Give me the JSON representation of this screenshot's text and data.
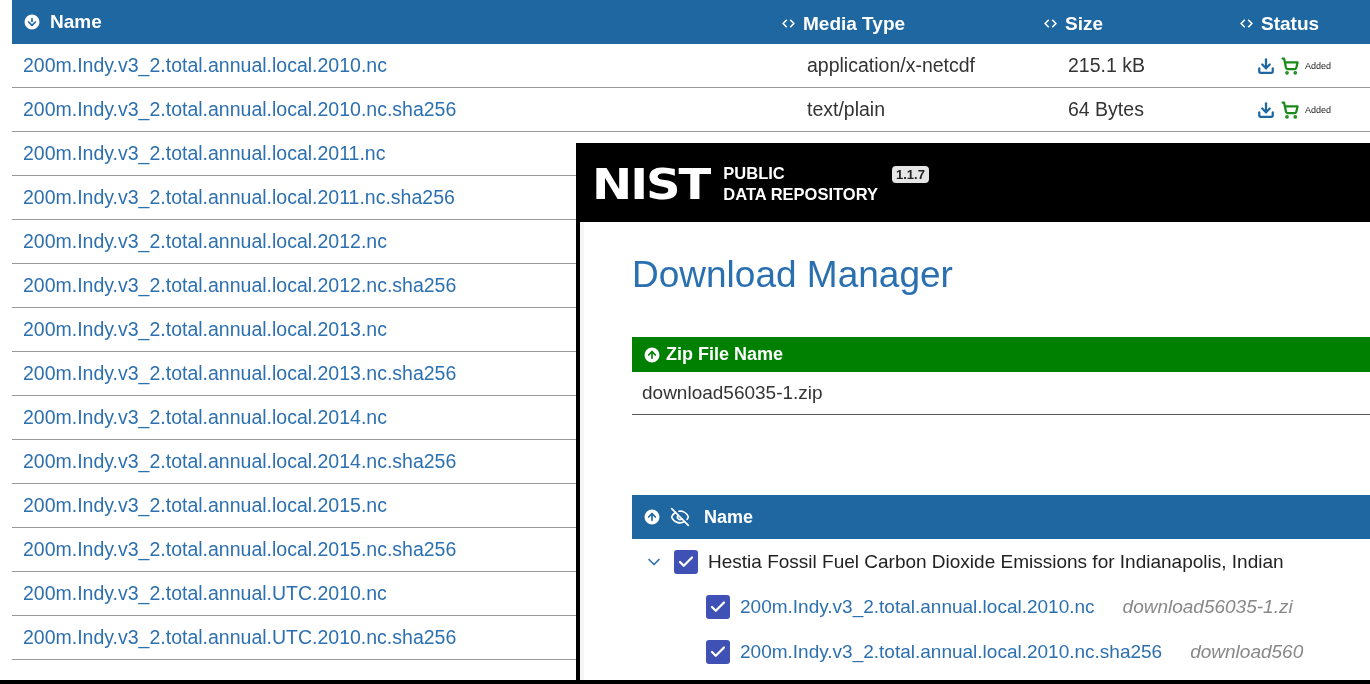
{
  "file_table": {
    "columns": [
      {
        "label": "Name",
        "kind": "sort"
      },
      {
        "label": "Media Type",
        "kind": "toggle"
      },
      {
        "label": "Size",
        "kind": "toggle"
      },
      {
        "label": "Status",
        "kind": "toggle"
      }
    ],
    "rows": [
      {
        "name": "200m.Indy.v3_2.total.annual.local.2010.nc",
        "media_type": "application/x-netcdf",
        "size": "215.1 kB",
        "status": "Added"
      },
      {
        "name": "200m.Indy.v3_2.total.annual.local.2010.nc.sha256",
        "media_type": "text/plain",
        "size": "64 Bytes",
        "status": "Added"
      },
      {
        "name": "200m.Indy.v3_2.total.annual.local.2011.nc"
      },
      {
        "name": "200m.Indy.v3_2.total.annual.local.2011.nc.sha256"
      },
      {
        "name": "200m.Indy.v3_2.total.annual.local.2012.nc"
      },
      {
        "name": "200m.Indy.v3_2.total.annual.local.2012.nc.sha256"
      },
      {
        "name": "200m.Indy.v3_2.total.annual.local.2013.nc"
      },
      {
        "name": "200m.Indy.v3_2.total.annual.local.2013.nc.sha256"
      },
      {
        "name": "200m.Indy.v3_2.total.annual.local.2014.nc"
      },
      {
        "name": "200m.Indy.v3_2.total.annual.local.2014.nc.sha256"
      },
      {
        "name": "200m.Indy.v3_2.total.annual.local.2015.nc"
      },
      {
        "name": "200m.Indy.v3_2.total.annual.local.2015.nc.sha256"
      },
      {
        "name": "200m.Indy.v3_2.total.annual.UTC.2010.nc"
      },
      {
        "name": "200m.Indy.v3_2.total.annual.UTC.2010.nc.sha256"
      }
    ]
  },
  "download_manager": {
    "logo": "NIST",
    "brand_lines": [
      "PUBLIC",
      "DATA REPOSITORY"
    ],
    "version": "1.1.7",
    "title": "Download Manager",
    "zip_header": "Zip File Name",
    "zip_name": "download56035-1.zip",
    "tree_header": "Name",
    "tree": [
      {
        "label": "Hestia Fossil Fuel Carbon Dioxide Emissions for Indianapolis, Indian",
        "checked": true,
        "expanded": true,
        "children": [
          {
            "label": "200m.Indy.v3_2.total.annual.local.2010.nc",
            "checked": true,
            "zip": "download56035-1.zi"
          },
          {
            "label": "200m.Indy.v3_2.total.annual.local.2010.nc.sha256",
            "checked": true,
            "zip": "download560"
          }
        ]
      }
    ]
  }
}
